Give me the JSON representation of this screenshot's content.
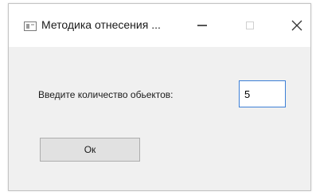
{
  "window": {
    "title": "Методика отнесения ..."
  },
  "form": {
    "count_label": "Введите количество обьектов:",
    "count_value": "5"
  },
  "buttons": {
    "ok_label": "Ок"
  },
  "icons": {
    "app": "window-app-icon",
    "minimize": "minimize-icon",
    "maximize": "maximize-icon",
    "close": "close-icon"
  },
  "colors": {
    "titlebar_bg": "#ffffff",
    "client_bg": "#f0f0f0",
    "input_focus_border": "#3c7fd6",
    "button_bg": "#e1e1e1"
  }
}
